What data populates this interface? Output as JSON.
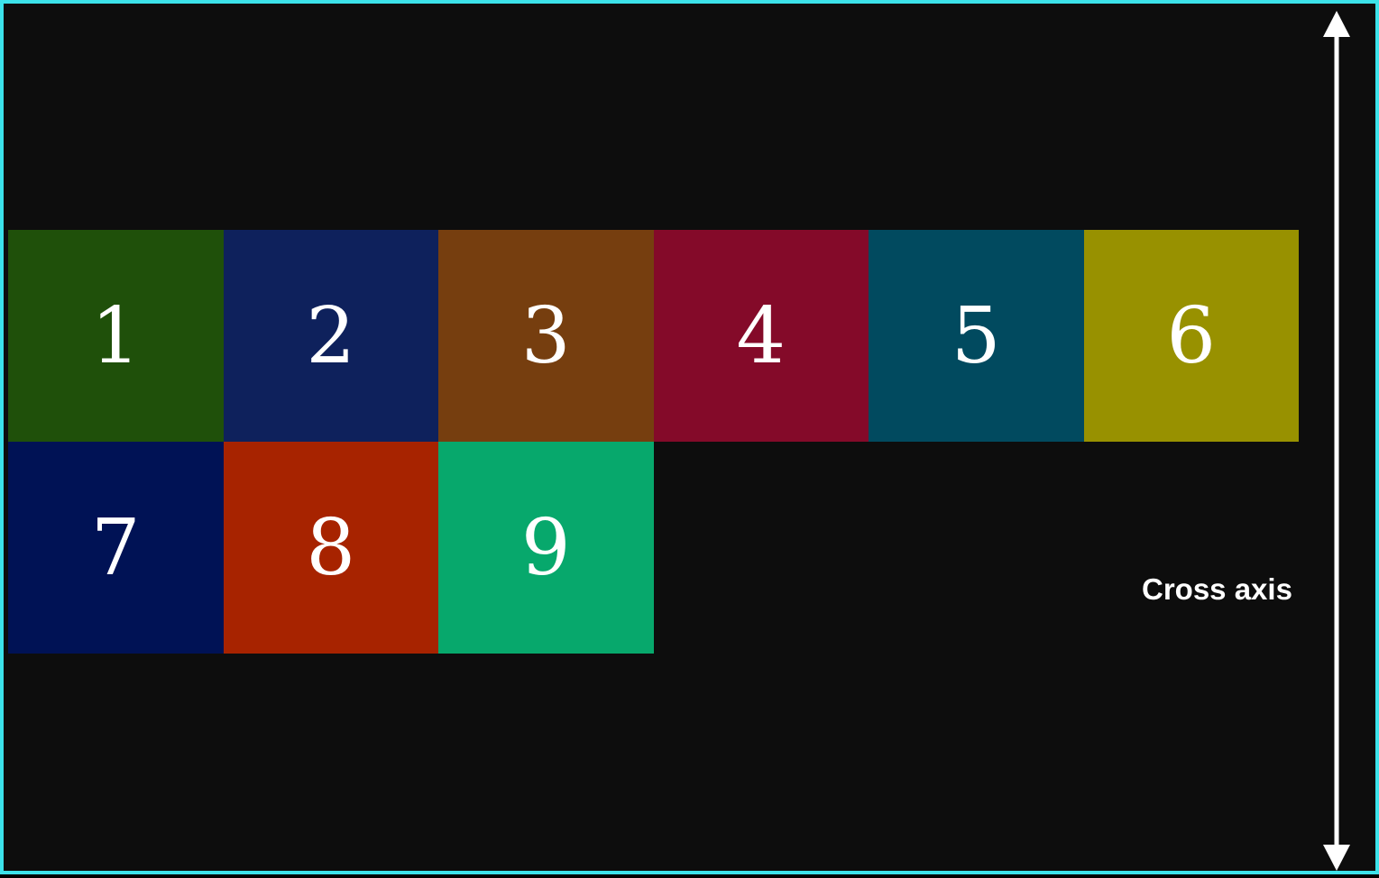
{
  "diagram": {
    "cross_axis_label": "Cross axis",
    "items": [
      {
        "label": "1",
        "color": "#1f500a"
      },
      {
        "label": "2",
        "color": "#0e215c"
      },
      {
        "label": "3",
        "color": "#763e0f"
      },
      {
        "label": "4",
        "color": "#840a29"
      },
      {
        "label": "5",
        "color": "#014a5f"
      },
      {
        "label": "6",
        "color": "#989100"
      },
      {
        "label": "7",
        "color": "#001255"
      },
      {
        "label": "8",
        "color": "#a72300"
      },
      {
        "label": "9",
        "color": "#07a86c"
      }
    ],
    "colors": {
      "background": "#0d0d0d",
      "frame_border": "#3ce2ea",
      "arrow": "#ffffff"
    }
  }
}
